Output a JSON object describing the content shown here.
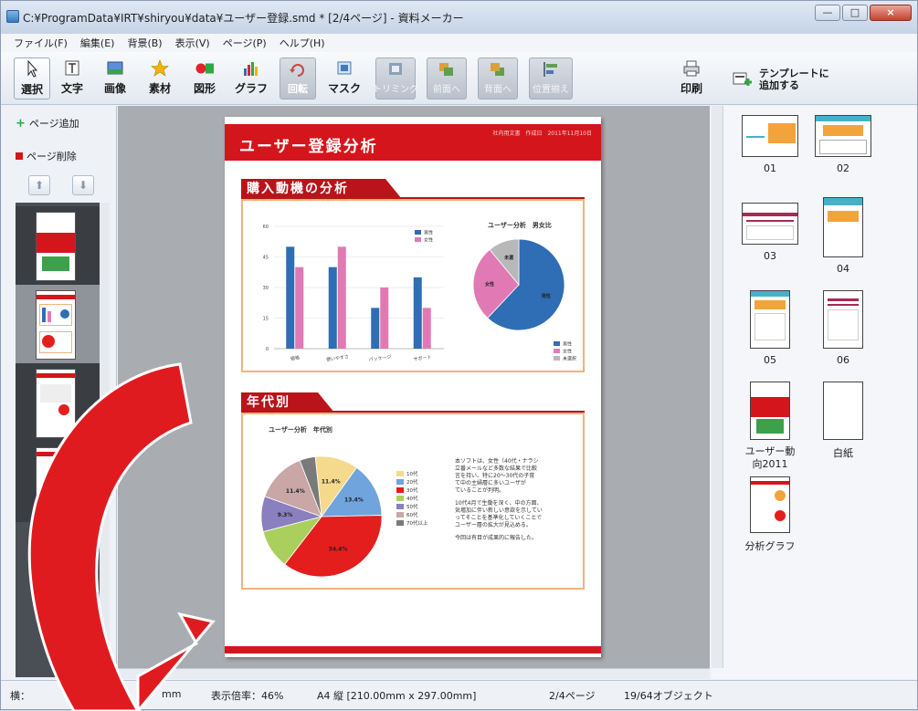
{
  "window": {
    "title": "C:¥ProgramData¥IRT¥shiryou¥data¥ユーザー登録.smd * [2/4ページ] - 資料メーカー",
    "min": "—",
    "max": "□",
    "close": "×"
  },
  "menu": [
    "ファイル(F)",
    "編集(E)",
    "背景(B)",
    "表示(V)",
    "ページ(P)",
    "ヘルプ(H)"
  ],
  "toolbar": {
    "tools": [
      {
        "label": "選択",
        "icon": "cursor-icon"
      },
      {
        "label": "文字",
        "icon": "text-icon"
      },
      {
        "label": "画像",
        "icon": "image-icon"
      },
      {
        "label": "素材",
        "icon": "star-icon"
      },
      {
        "label": "図形",
        "icon": "shapes-icon"
      },
      {
        "label": "グラフ",
        "icon": "bar-chart-icon"
      },
      {
        "label": "回転",
        "icon": "rotate-icon"
      },
      {
        "label": "マスク",
        "icon": "mask-icon"
      },
      {
        "label": "トリミング",
        "icon": "trim-icon"
      },
      {
        "label": "前面へ",
        "icon": "bring-front-icon"
      },
      {
        "label": "背面へ",
        "icon": "send-back-icon"
      },
      {
        "label": "位置揃え",
        "icon": "align-icon"
      },
      {
        "label": "印刷",
        "icon": "print-icon"
      }
    ],
    "template_line1": "テンプレートに",
    "template_line2": "追加する"
  },
  "left_panel": {
    "add_page": "ページ追加",
    "delete_page": "ページ削除",
    "up": "⬆",
    "down": "⬇"
  },
  "page": {
    "title": "ユーザー登録分析",
    "meta": "社内用文書　作成日　2011年11月10日",
    "section1_title": "購入動機の分析",
    "section2_title": "年代別",
    "pie1_title": "ユーザー分析　男女比",
    "pie2_title": "ユーザー分析　年代別",
    "note_lines": [
      "本ソフトは、女性（40代・ナラシ",
      "立番メールなど多数な結果で比較",
      "言を持い、特に20～30代の子育",
      "て中の主婦層に多いユーザが",
      "ていることが判明。",
      "",
      "10代4月で生働を深く、中の方面、",
      "気増加に伴い新しい意欲を示してい",
      "ってそことを基準化していくことで",
      "ユーザー層の拡大が見込める。",
      "",
      "今回は有目が成果的に報告した。"
    ]
  },
  "chart_data": [
    {
      "type": "bar",
      "title": "",
      "categories": [
        "価格",
        "使いやすさ",
        "パッケージ",
        "サポート"
      ],
      "series": [
        {
          "name": "男性",
          "values": [
            50,
            40,
            20,
            35
          ],
          "color": "#2f6db5"
        },
        {
          "name": "女性",
          "values": [
            40,
            50,
            30,
            20
          ],
          "color": "#e17ab4"
        }
      ],
      "ylim": [
        0,
        60
      ],
      "yticks": [
        "0",
        "15",
        "30",
        "45",
        "60"
      ],
      "grid": true,
      "legend": "top-right"
    },
    {
      "type": "pie",
      "title": "ユーザー分析　男女比",
      "slices": [
        {
          "name": "男性",
          "label": "男性",
          "value": 62,
          "color": "#2f6db5"
        },
        {
          "name": "女性",
          "label": "女性",
          "value": 27,
          "color": "#e17ab4"
        },
        {
          "name": "未選択",
          "label": "未選",
          "value": 11,
          "color": "#b8b8b8"
        }
      ],
      "legend": "bottom-right"
    },
    {
      "type": "pie",
      "title": "ユーザー分析　年代別",
      "slices": [
        {
          "name": "10代",
          "label": "11.4%",
          "value": 11,
          "color": "#f5d98c"
        },
        {
          "name": "20代",
          "label": "13.4%",
          "value": 14,
          "color": "#6fa4dc"
        },
        {
          "name": "30代",
          "label": "34.4%",
          "value": 34,
          "color": "#e41d1d"
        },
        {
          "name": "40代",
          "label": "",
          "value": 10,
          "color": "#aacf5d"
        },
        {
          "name": "50代",
          "label": "9.3%",
          "value": 9,
          "color": "#8a7fbf"
        },
        {
          "name": "60代",
          "label": "11.4%",
          "value": 13,
          "color": "#c9a7a7"
        },
        {
          "name": "70代以上",
          "label": "",
          "value": 4,
          "color": "#7a7a7a"
        }
      ],
      "legend": "right"
    }
  ],
  "templates": [
    {
      "caption": "01"
    },
    {
      "caption": "02"
    },
    {
      "caption": "03"
    },
    {
      "caption": "04"
    },
    {
      "caption": "05"
    },
    {
      "caption": "06"
    },
    {
      "caption": "ユーザー動向2011"
    },
    {
      "caption": "白紙"
    },
    {
      "caption": "分析グラフ"
    }
  ],
  "status": {
    "left": "横：",
    "unit": "mm",
    "zoom": "表示倍率：46%",
    "paper": "A4 縦 [210.00mm x 297.00mm]",
    "page": "2/4ページ",
    "objects": "19/64オブジェクト"
  }
}
